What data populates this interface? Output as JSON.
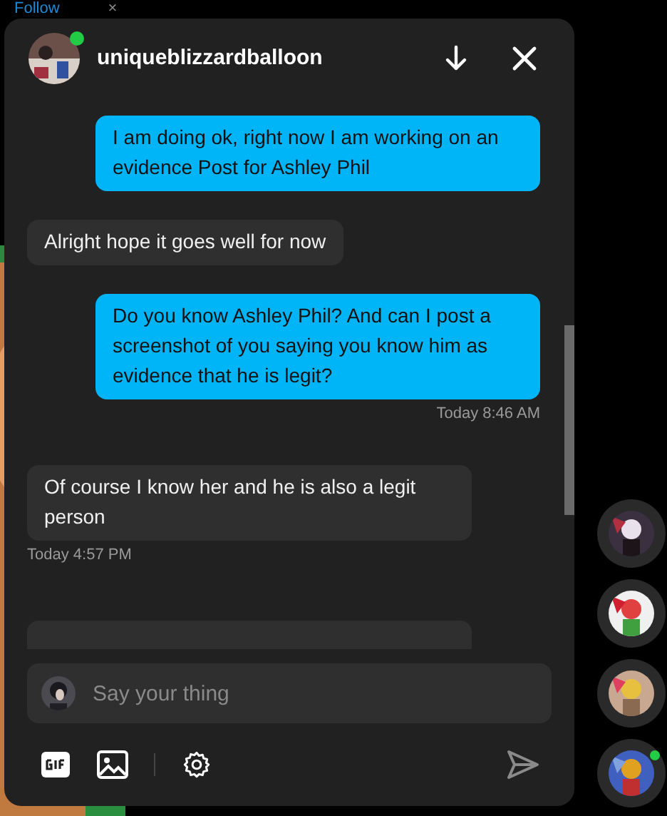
{
  "background": {
    "follow_link": "Follow",
    "dismiss": "×"
  },
  "chat": {
    "username": "uniqueblizzardballoon",
    "online": true,
    "messages": [
      {
        "kind": "sent",
        "text": "I am doing ok, right now I am working on an evidence Post for Ashley Phil"
      },
      {
        "kind": "received",
        "text": "Alright hope it goes well for now"
      },
      {
        "kind": "sent",
        "text": "Do you know Ashley Phil? And can I post a screenshot of you saying you know him as evidence that he is legit?",
        "time": "Today 8:46 AM"
      },
      {
        "kind": "received",
        "text": "Of course I know her and he is also a legit person",
        "time": "Today 4:57 PM"
      }
    ],
    "composer": {
      "placeholder": "Say your thing"
    }
  },
  "side_chats": [
    {
      "online": false
    },
    {
      "online": false
    },
    {
      "online": false
    },
    {
      "online": true
    }
  ]
}
